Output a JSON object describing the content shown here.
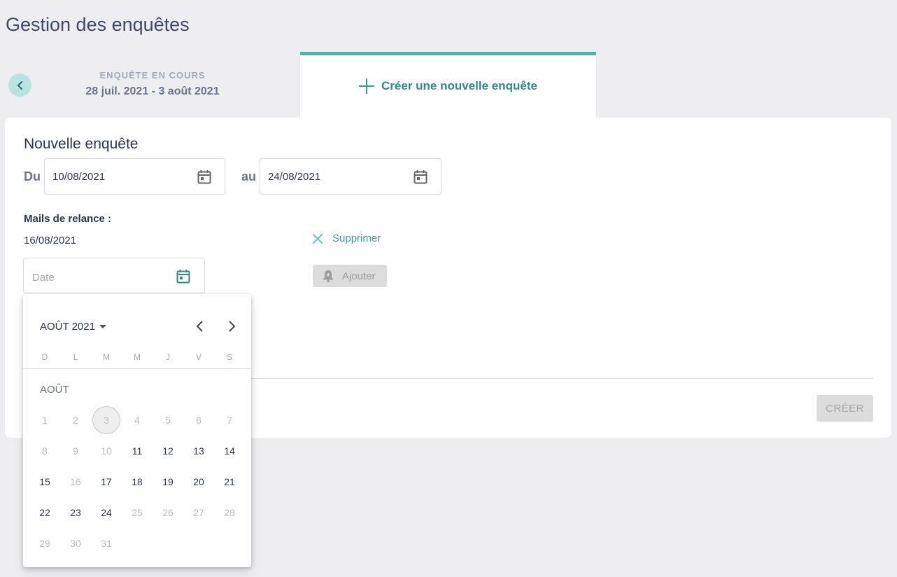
{
  "page": {
    "title": "Gestion des enquêtes"
  },
  "current_survey": {
    "label": "ENQUÊTE EN COURS",
    "dates": "28 juil. 2021 - 3 août 2021"
  },
  "new_tab": {
    "label": "Créer une nouvelle enquête",
    "icon": "plus-icon"
  },
  "form": {
    "title": "Nouvelle enquête",
    "from_label": "Du",
    "from_value": "10/08/2021",
    "to_label": "au",
    "to_value": "24/08/2021",
    "reminders_label": "Mails de relance :",
    "reminders": [
      {
        "date": "16/08/2021",
        "delete_label": "Supprimer"
      }
    ],
    "date_placeholder": "Date",
    "add_label": "Ajouter",
    "create_label": "CRÉER"
  },
  "colors": {
    "accent": "#4db3a9",
    "accent_dark": "#2f8a80",
    "title": "#41476c",
    "disabled_bg": "#dcdcdc"
  },
  "datepicker": {
    "month_year": "AOÛT 2021",
    "month_label": "AOÛT",
    "weekdays": [
      "D",
      "L",
      "M",
      "M",
      "J",
      "V",
      "S"
    ],
    "today": 3,
    "days": [
      {
        "d": "1",
        "enabled": false
      },
      {
        "d": "2",
        "enabled": false
      },
      {
        "d": "3",
        "enabled": false
      },
      {
        "d": "4",
        "enabled": false
      },
      {
        "d": "5",
        "enabled": false
      },
      {
        "d": "6",
        "enabled": false
      },
      {
        "d": "7",
        "enabled": false
      },
      {
        "d": "8",
        "enabled": false
      },
      {
        "d": "9",
        "enabled": false
      },
      {
        "d": "10",
        "enabled": false
      },
      {
        "d": "11",
        "enabled": true
      },
      {
        "d": "12",
        "enabled": true
      },
      {
        "d": "13",
        "enabled": true
      },
      {
        "d": "14",
        "enabled": true
      },
      {
        "d": "15",
        "enabled": true
      },
      {
        "d": "16",
        "enabled": false
      },
      {
        "d": "17",
        "enabled": true
      },
      {
        "d": "18",
        "enabled": true
      },
      {
        "d": "19",
        "enabled": true
      },
      {
        "d": "20",
        "enabled": true
      },
      {
        "d": "21",
        "enabled": true
      },
      {
        "d": "22",
        "enabled": true
      },
      {
        "d": "23",
        "enabled": true
      },
      {
        "d": "24",
        "enabled": true
      },
      {
        "d": "25",
        "enabled": false
      },
      {
        "d": "26",
        "enabled": false
      },
      {
        "d": "27",
        "enabled": false
      },
      {
        "d": "28",
        "enabled": false
      },
      {
        "d": "29",
        "enabled": false
      },
      {
        "d": "30",
        "enabled": false
      },
      {
        "d": "31",
        "enabled": false
      }
    ]
  }
}
